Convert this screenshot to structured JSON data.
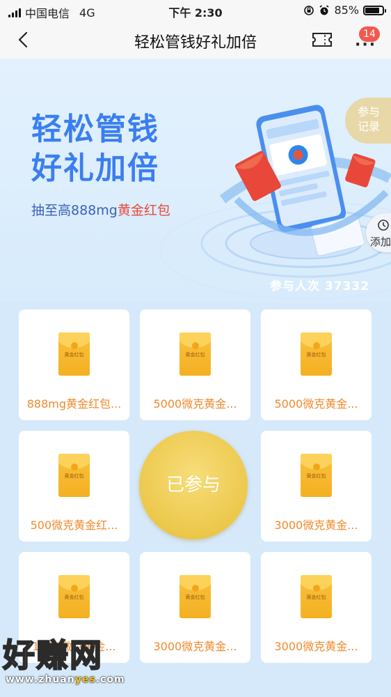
{
  "status_bar": {
    "carrier": "中国电信",
    "network": "4G",
    "time": "下午 2:30",
    "battery_percent": "85%",
    "battery_level": 0.85
  },
  "nav": {
    "title": "轻松管钱好礼加倍",
    "badge": "14",
    "icons": {
      "back": "chevron-left-icon",
      "ticket": "ticket-icon",
      "more": "more-icon"
    }
  },
  "hero": {
    "title_line1": "轻松管钱",
    "title_line2": "好礼加倍",
    "subtitle_prefix": "抽至高888mg",
    "subtitle_accent": "黄金红包",
    "record_line1": "参与",
    "record_line2": "记录",
    "add_label": "添加",
    "participants": "参与人次 37332"
  },
  "prizes": [
    {
      "label": "888mg黄金红包..."
    },
    {
      "label": "5000微克黄金..."
    },
    {
      "label": "5000微克黄金..."
    },
    {
      "label": "500微克黄金红..."
    },
    {
      "label": "3000微克黄金..."
    },
    {
      "label": "1000微克黄金..."
    },
    {
      "label": "3000微克黄金..."
    },
    {
      "label": "3000微克黄金..."
    }
  ],
  "envelope_text": "黄金红包",
  "join_button": "已参与",
  "watermark": {
    "brand": "好赚网",
    "url_part1": "www.zhuan",
    "url_part2": "yes",
    "url_part3": ".com"
  },
  "colors": {
    "accent_blue": "#3a7ff0",
    "prize_orange": "#f08a2c",
    "gold": "#ecc84b",
    "badge_red": "#f25a4f"
  }
}
